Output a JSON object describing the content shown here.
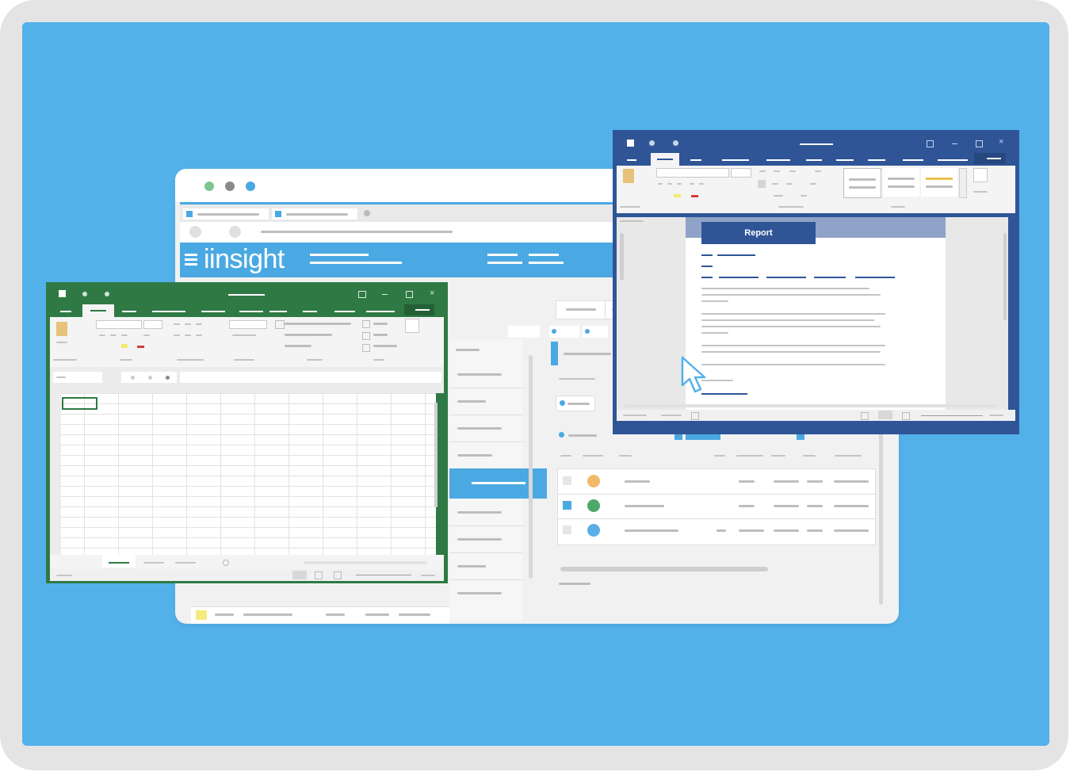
{
  "browser": {
    "logo_text": "iinsight",
    "traffic_colors": [
      "#7fc58f",
      "#8a8a8a",
      "#4aa9e2"
    ]
  },
  "word": {
    "report_label": "Report",
    "window_controls": [
      "minimize-icon",
      "restore-icon",
      "close-icon"
    ]
  },
  "excel": {
    "window_controls": [
      "minimize-icon",
      "restore-icon",
      "close-icon"
    ]
  },
  "colors": {
    "background": "#53b1ea",
    "excel_green": "#2f7a44",
    "word_blue": "#2f5597",
    "insight_blue": "#4aa9e2"
  },
  "table_rows": [
    {
      "status_color": "#f2b968"
    },
    {
      "status_color": "#4da86a"
    },
    {
      "status_color": "#5aaee6"
    }
  ]
}
